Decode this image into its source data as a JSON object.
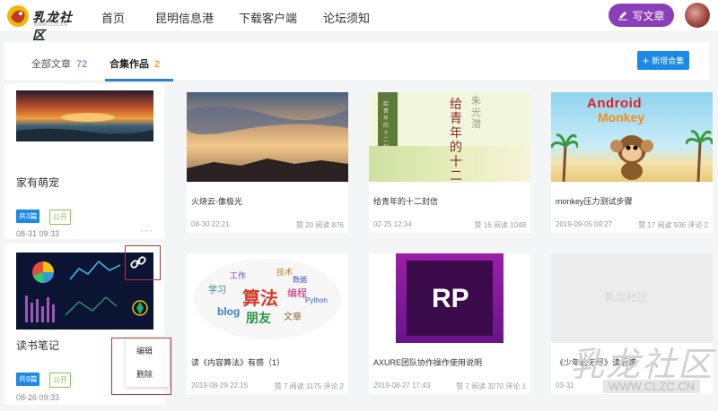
{
  "header": {
    "logo_text": "乳龙社区",
    "logo_url": "WWW.CLZC.CN",
    "nav": [
      "首页",
      "昆明信息港",
      "下载客户端",
      "论坛须知"
    ],
    "write_label": "写文章"
  },
  "tabs": {
    "all_label": "全部文章",
    "all_count": "72",
    "collections_label": "合集作品",
    "collections_count": "2",
    "new_collection_label": "新增合集"
  },
  "collections": [
    {
      "title": "家有萌宠",
      "count_badge": "共3篇",
      "status": "公开",
      "date": "08-31 09:33"
    },
    {
      "title": "读书笔记",
      "count_badge": "共9篇",
      "status": "公开",
      "date": "08-26 09:33"
    }
  ],
  "context_menu": {
    "edit": "编辑",
    "delete": "删除"
  },
  "articles": [
    {
      "title": "火烧云-像极光",
      "date": "08-30 22:21",
      "stats": "赞 20 阅读 876"
    },
    {
      "title": "给青年的十二封信",
      "date": "02-25 12:34",
      "stats": "赞 16 阅读 1048",
      "cover_text": "给青年的十二封信",
      "cover_author": "朱光潜"
    },
    {
      "title": "monkey压力测试步骤",
      "date": "2019-09-05 09:27",
      "stats": "赞 17 阅读 936 评论 2",
      "cover_text_1": "Android",
      "cover_text_2": "Monkey"
    },
    {
      "title": "读《内容算法》有感（1）",
      "date": "2019-08-29 22:15",
      "stats": "赞 7 阅读 1175 评论 2",
      "cover_text": "算法",
      "cover_words": [
        "blog",
        "朋友",
        "工作",
        "技术",
        "学习",
        "编程",
        "数据",
        "文章",
        "Python"
      ]
    },
    {
      "title": "AXURE团队协作操作使用说明",
      "date": "2019-08-27 17:43",
      "stats": "赞 7 阅读 3270 评论 1",
      "cover_text": "RP"
    },
    {
      "title": "《少年的无尽》读后感",
      "date": "03-31",
      "stats": "",
      "cover_text": "乳龙社区"
    }
  ],
  "watermark": {
    "text": "乳龙社区",
    "url": "WWW.CLZC.CN"
  },
  "colors": {
    "primary": "#1a8ae6",
    "write_button": "#8a3fb8",
    "badge_green": "#8bc34a",
    "count_orange": "#e8a218",
    "highlight_red": "#b83232"
  }
}
